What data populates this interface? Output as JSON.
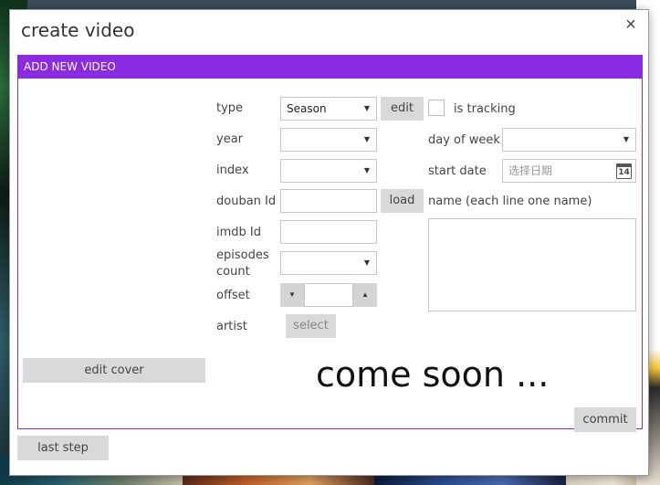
{
  "dialog": {
    "title": "create video",
    "close_glyph": "×"
  },
  "panel": {
    "header": "ADD NEW VIDEO"
  },
  "form": {
    "type_label": "type",
    "type_value": "Season",
    "edit_label": "edit",
    "is_tracking_label": "is tracking",
    "is_tracking_checked": false,
    "year_label": "year",
    "year_value": "",
    "day_of_week_label": "day of week",
    "day_of_week_value": "",
    "index_label": "index",
    "index_value": "",
    "start_date_label": "start date",
    "start_date_placeholder": "选择日期",
    "calendar_day": "14",
    "douban_label": "douban Id",
    "douban_value": "",
    "load_label": "load",
    "name_label": "name (each line one name)",
    "name_value": "",
    "imdb_label": "imdb Id",
    "imdb_value": "",
    "episodes_label_1": "episodes",
    "episodes_label_2": "count",
    "episodes_value": "",
    "offset_label": "offset",
    "offset_value": "",
    "artist_label": "artist",
    "select_label": "select"
  },
  "cover": {
    "edit_cover_label": "edit cover"
  },
  "main": {
    "coming_soon": "come soon ..."
  },
  "actions": {
    "commit_label": "commit",
    "last_step_label": "last step"
  },
  "icons": {
    "dropdown": "chevron-down-icon",
    "close": "close-icon",
    "calendar": "calendar-icon",
    "stepper_down": "triangle-down-icon",
    "stepper_up": "triangle-up-icon"
  },
  "colors": {
    "accent": "#8a2be2",
    "button_bg": "#d9d9d9"
  }
}
